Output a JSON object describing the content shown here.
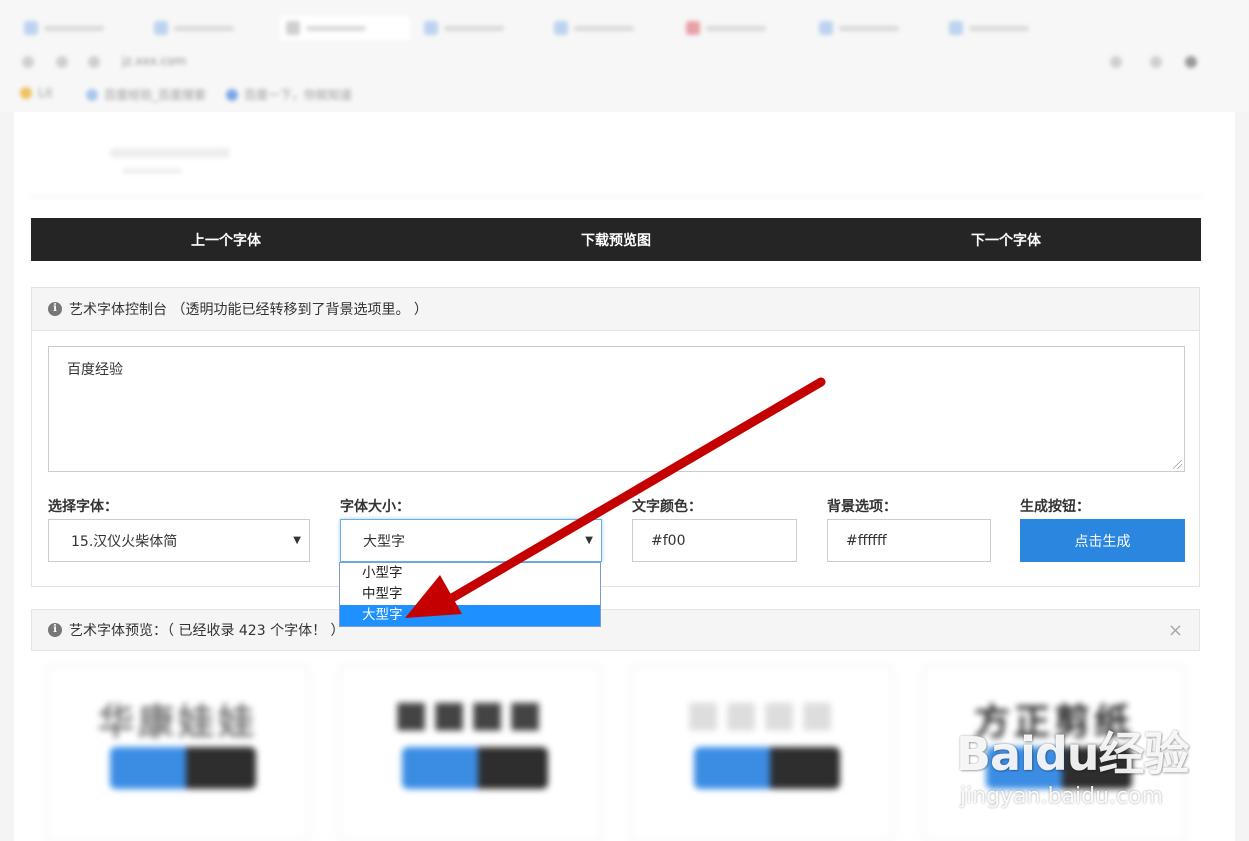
{
  "browser": {
    "url": "jz.xxx.com",
    "bookmarks": [
      {
        "label": "Lit"
      },
      {
        "label": "百度经验_百度搜索"
      },
      {
        "label": "百度一下，你就知道"
      }
    ]
  },
  "nav": {
    "prev_label": "上一个字体",
    "download_label": "下载预览图",
    "next_label": "下一个字体"
  },
  "console": {
    "header": "艺术字体控制台 （透明功能已经转移到了背景选项里。 ）",
    "info_glyph": "i",
    "text_value": "百度经验",
    "font_label": "选择字体：",
    "font_value": "15.汉仪火柴体简",
    "size_label": "字体大小：",
    "size_value": "大型字",
    "color_label": "文字颜色：",
    "color_value": "#f00",
    "bg_label": "背景选项：",
    "bg_value": "#ffffff",
    "gen_label": "生成按钮：",
    "gen_button": "点击生成"
  },
  "size_options": [
    "小型字",
    "中型字",
    "大型字"
  ],
  "preview": {
    "header": "艺术字体预览：（ 已经收录 423 个字体！ ）",
    "info_glyph": "i",
    "close": "×",
    "cards": [
      {
        "sample": "华康娃娃"
      },
      {
        "sample": "■■■■"
      },
      {
        "sample": "■■■■"
      },
      {
        "sample": "方正剪纸"
      }
    ]
  },
  "watermark": {
    "logo": "Baidu经验",
    "url": "jingyan.baidu.com"
  },
  "colors": {
    "nav_bg": "#252525",
    "button_blue": "#2b86e0",
    "selected_option": "#1e90ff",
    "arrow_red": "#c40000"
  }
}
